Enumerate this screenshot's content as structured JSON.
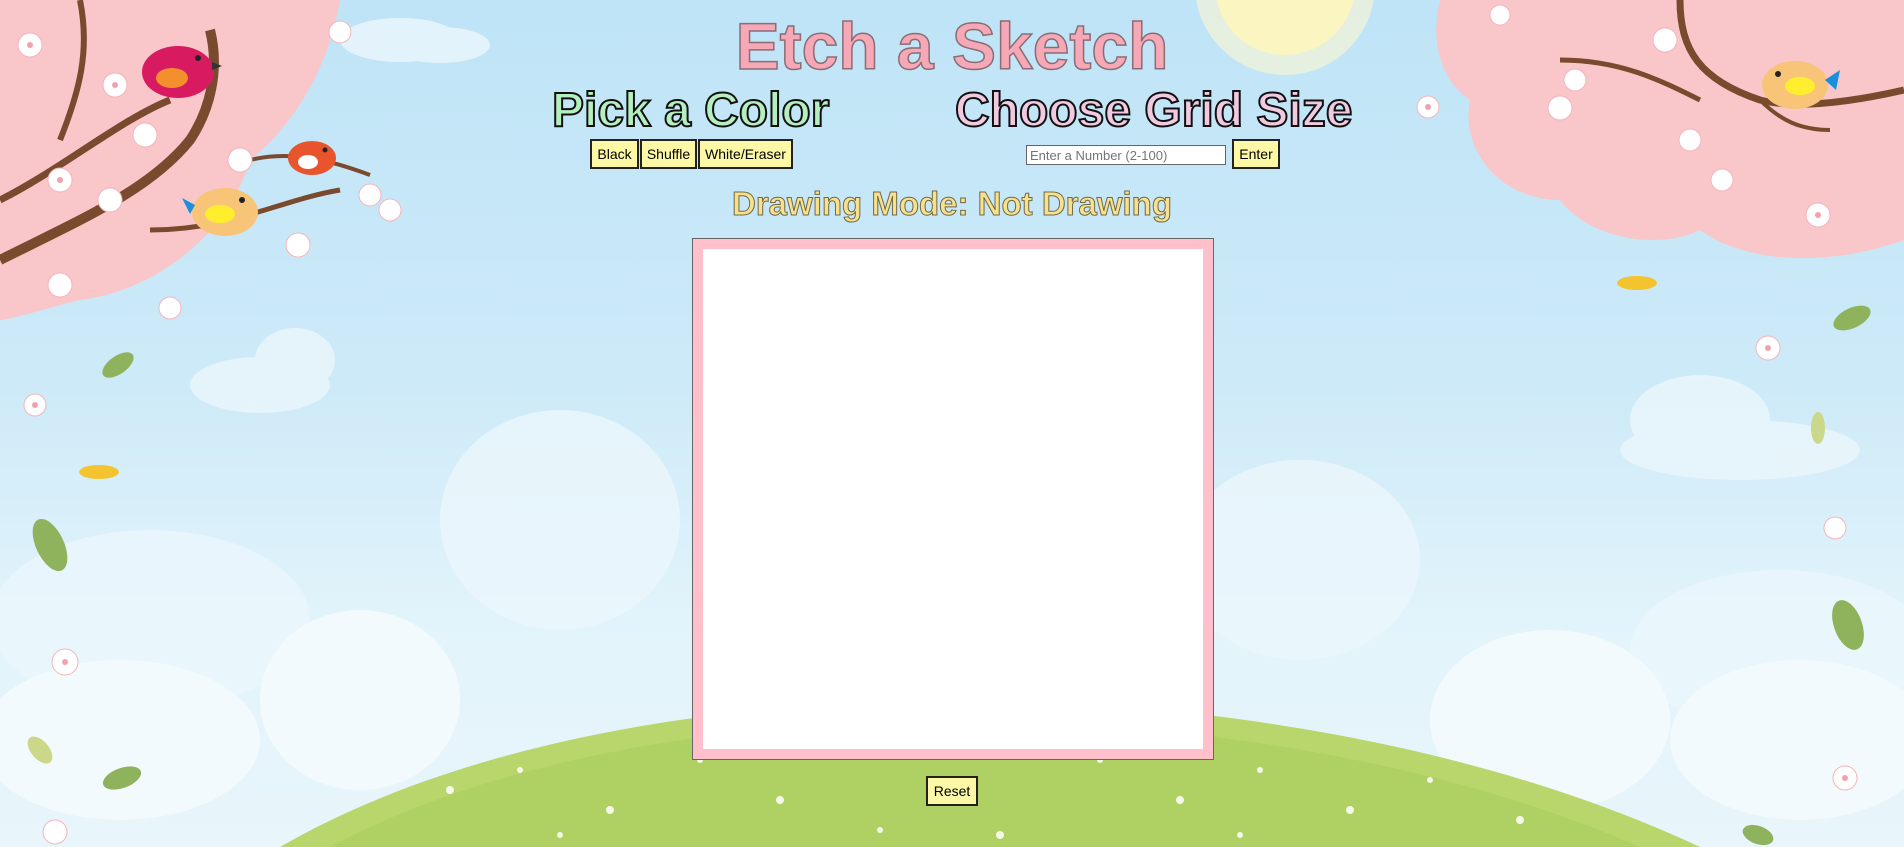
{
  "app": {
    "title": "Etch a Sketch"
  },
  "color_picker": {
    "heading": "Pick a Color",
    "buttons": [
      {
        "label": "Black"
      },
      {
        "label": "Shuffle"
      },
      {
        "label": "White/Eraser"
      }
    ]
  },
  "grid_size": {
    "heading": "Choose Grid Size",
    "input_value": "",
    "input_placeholder": "Enter a Number (2-100)",
    "enter_label": "Enter"
  },
  "status": {
    "label": "Drawing Mode:",
    "value": "Not Drawing"
  },
  "board": {
    "border_color": "#ffc0cb",
    "background_color": "#ffffff"
  },
  "controls": {
    "reset_label": "Reset"
  },
  "background": {
    "sky_color": "#bfe4f7",
    "blossom_color": "#f9c6c9",
    "grass_color": "#b8d66c",
    "icons": [
      "sun-icon",
      "cloud-icon",
      "cherry-blossom-branch-icon",
      "bird-icon",
      "flower-icon",
      "leaf-icon",
      "grassy-hill-icon"
    ]
  }
}
